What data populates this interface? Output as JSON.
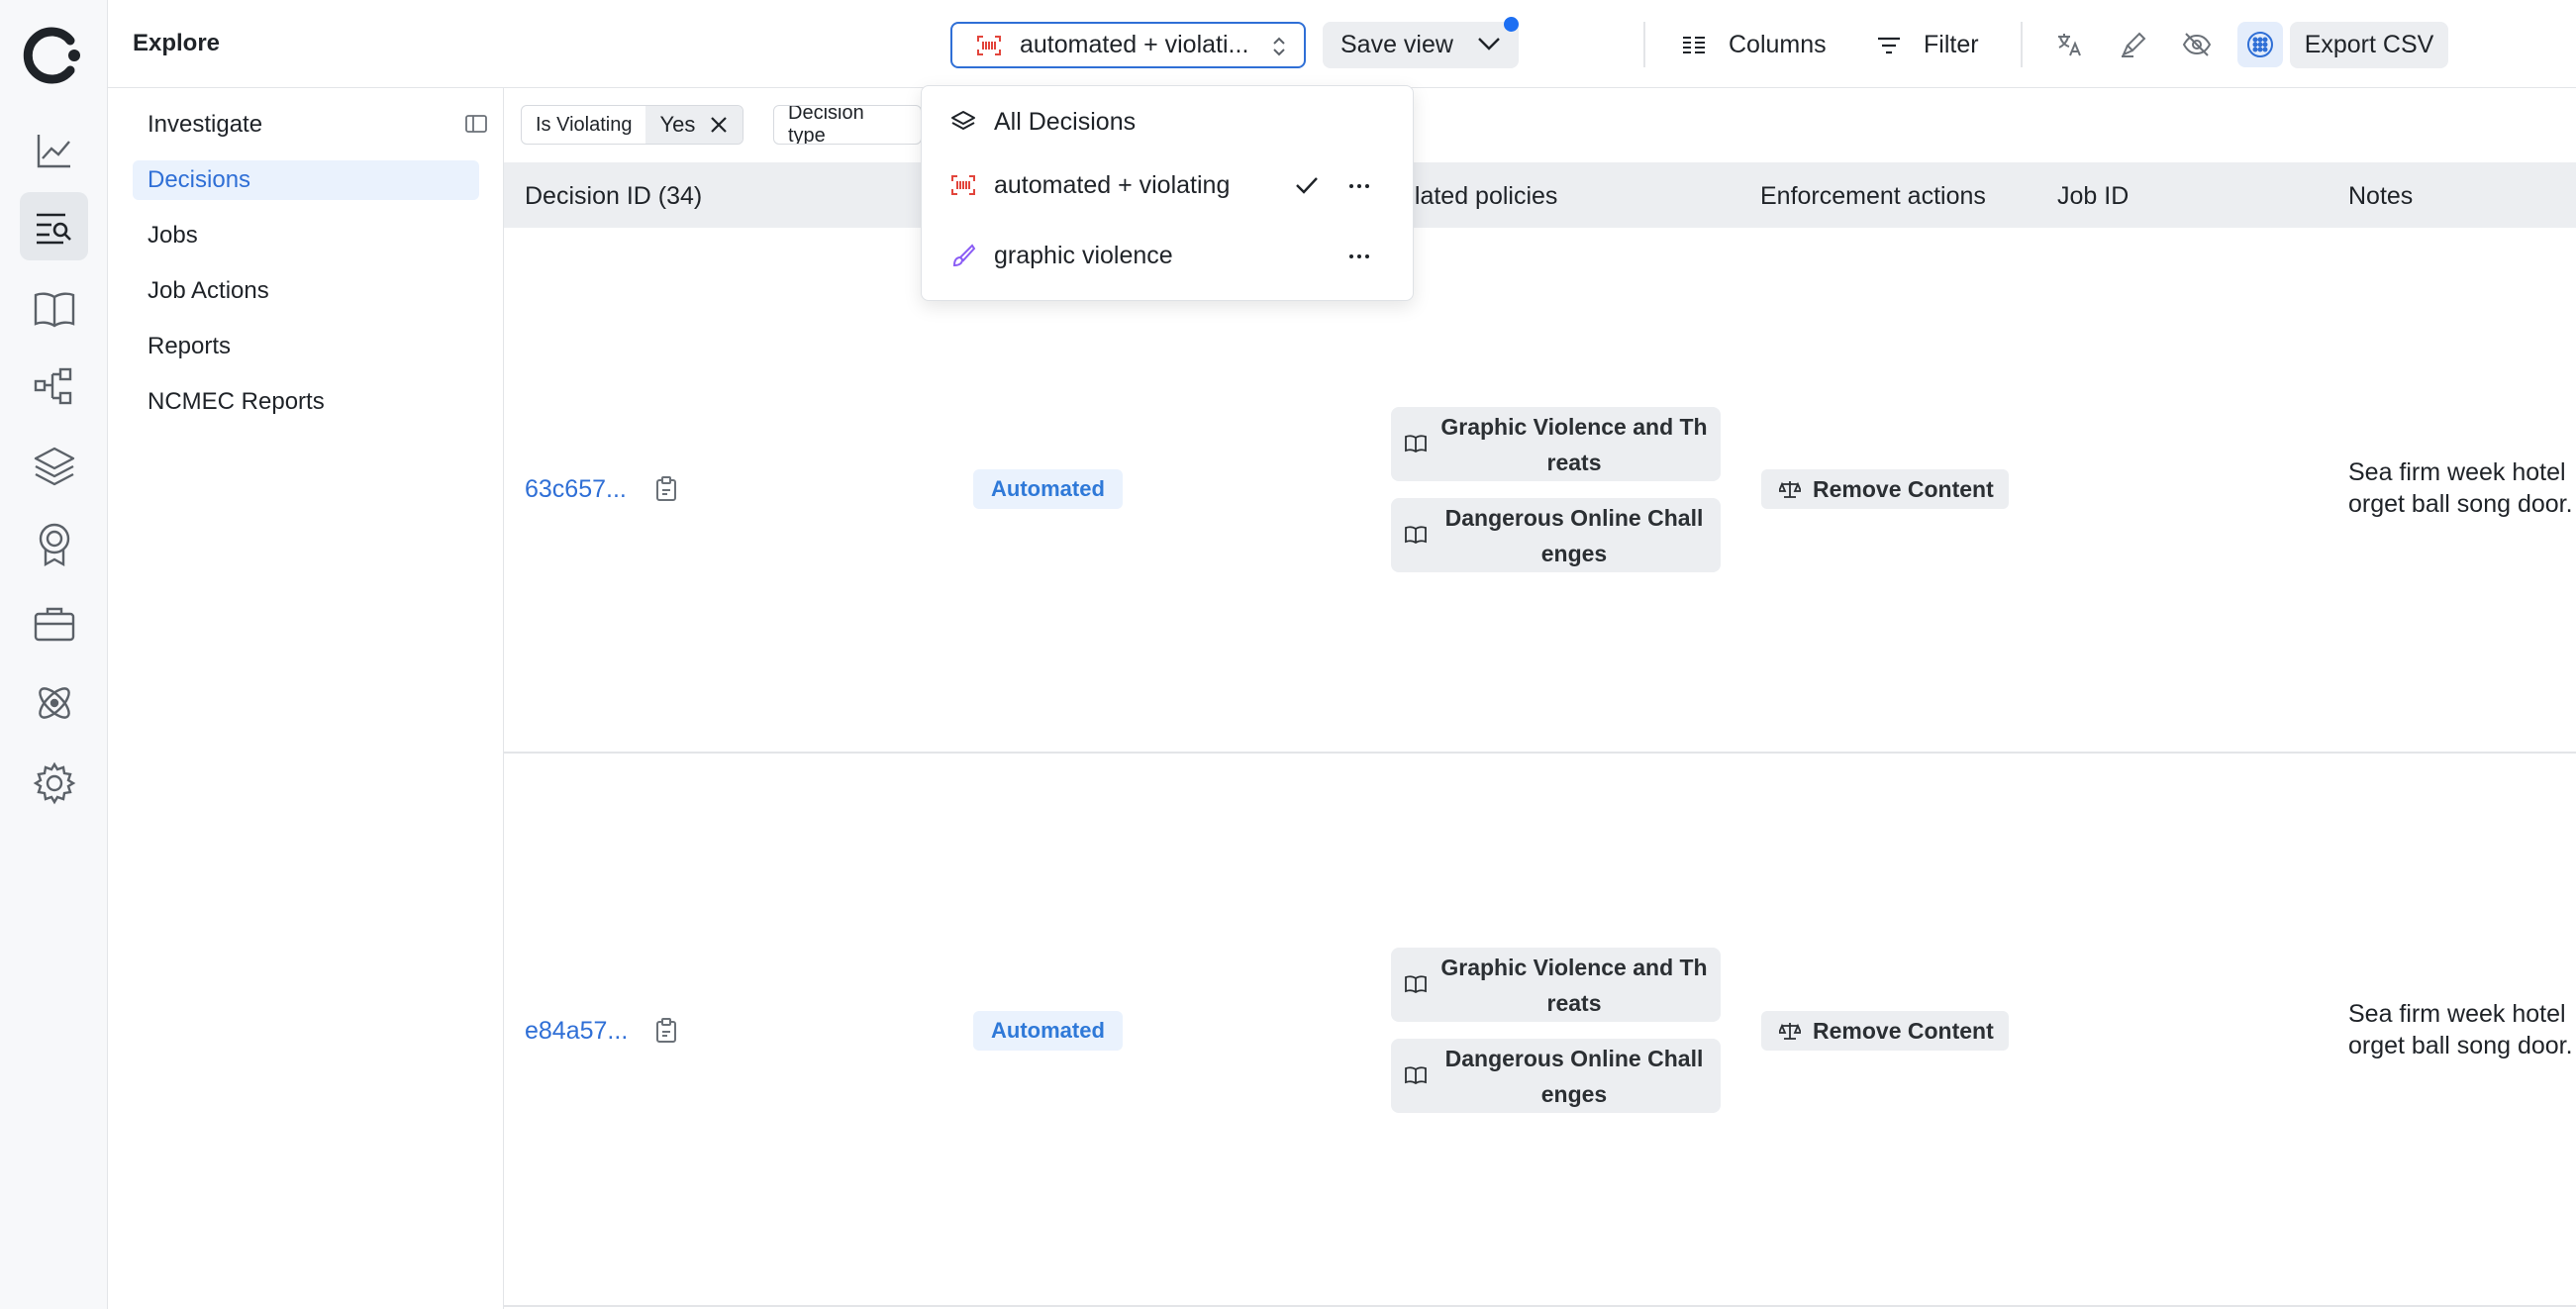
{
  "header": {
    "title": "Explore"
  },
  "toolbar": {
    "view_selected": "automated + violati...",
    "save_view": "Save view",
    "columns": "Columns",
    "filter": "Filter",
    "export": "Export CSV"
  },
  "sidebar": {
    "items": [
      {
        "label": "Investigate"
      },
      {
        "label": "Decisions"
      },
      {
        "label": "Jobs"
      },
      {
        "label": "Job Actions"
      },
      {
        "label": "Reports"
      },
      {
        "label": "NCMEC Reports"
      }
    ]
  },
  "filters": [
    {
      "key": "Is Violating",
      "value": "Yes"
    },
    {
      "key": "Decision type"
    }
  ],
  "views_menu": {
    "items": [
      {
        "label": "All Decisions",
        "icon": "layers-icon"
      },
      {
        "label": "automated + violating",
        "icon": "barcode-icon",
        "selected": true
      },
      {
        "label": "graphic violence",
        "icon": "brush-icon"
      }
    ]
  },
  "table": {
    "columns": [
      "Decision ID (34)",
      "olated policies",
      "Enforcement actions",
      "Job ID",
      "Notes"
    ],
    "rows": [
      {
        "id": "63c657...",
        "type": "Automated",
        "policies": [
          "Graphic Violence and Threats",
          "Dangerous Online Challenges"
        ],
        "action": "Remove Content",
        "job_id": "",
        "notes_line1": "Sea firm week hotel",
        "notes_line2": "orget ball song door."
      },
      {
        "id": "e84a57...",
        "type": "Automated",
        "policies": [
          "Graphic Violence and Threats",
          "Dangerous Online Challenges"
        ],
        "action": "Remove Content",
        "job_id": "",
        "notes_line1": "Sea firm week hotel",
        "notes_line2": "orget ball song door."
      }
    ]
  },
  "colors": {
    "accent": "#2f6fd6",
    "badge_text": "#2f79d8",
    "notification_dot": "#1d6ff2",
    "barcode_icon": "#e2453c",
    "brush_icon": "#8a5cf5"
  }
}
